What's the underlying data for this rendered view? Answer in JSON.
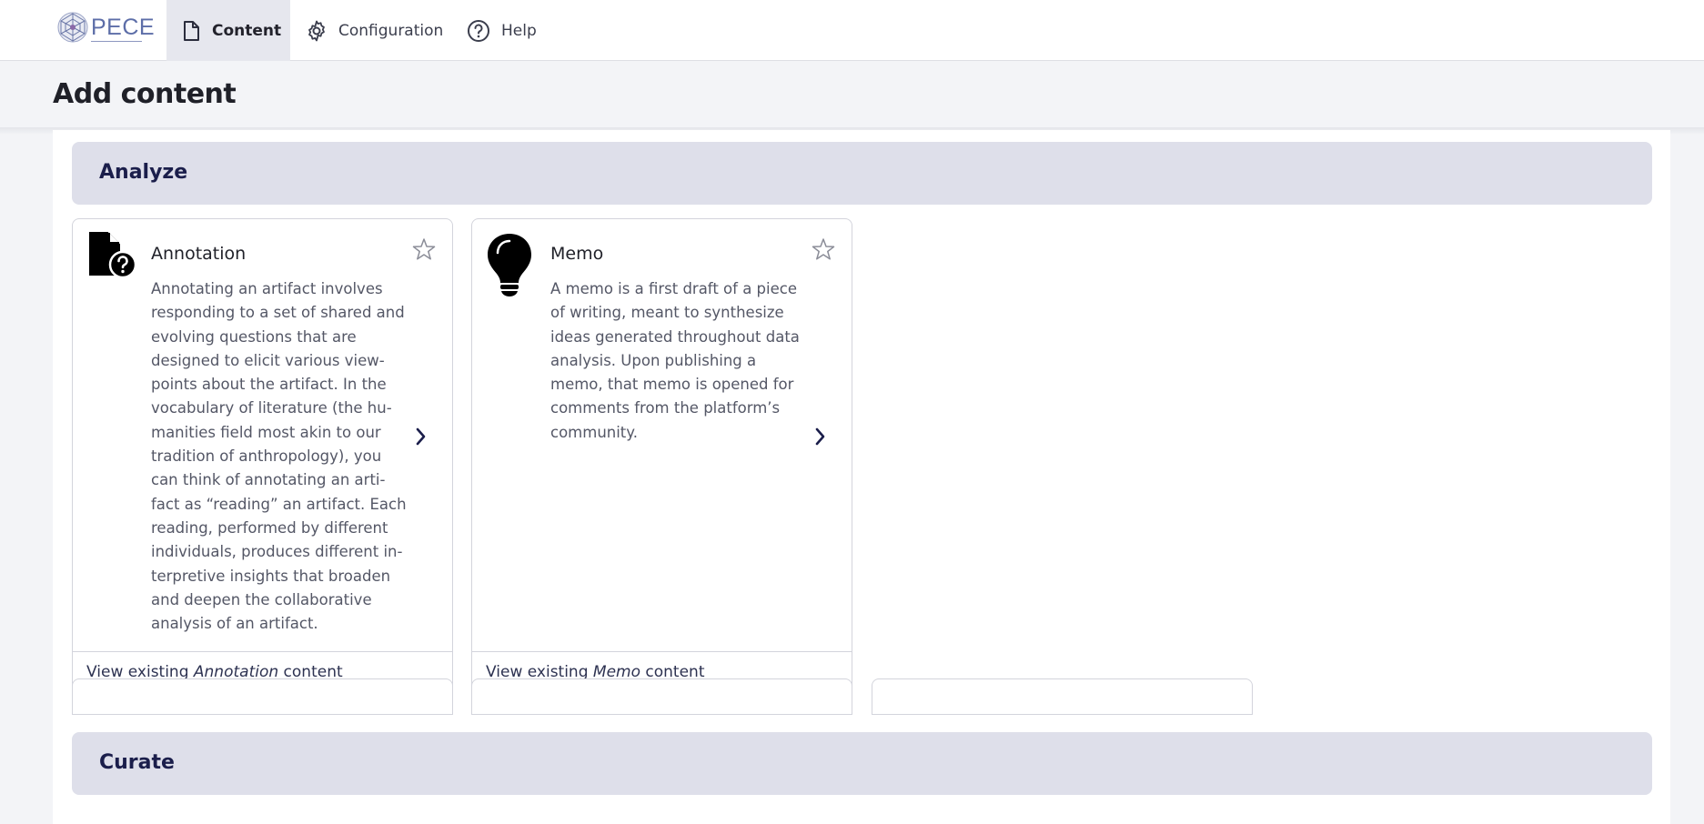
{
  "header": {
    "logo_text": "PECE",
    "tabs": [
      {
        "label": "Content",
        "icon": "document-icon",
        "active": true
      },
      {
        "label": "Configuration",
        "icon": "gear-icon",
        "active": false
      },
      {
        "label": "Help",
        "icon": "question-circle-icon",
        "active": false
      }
    ]
  },
  "page": {
    "title": "Add content"
  },
  "sections": [
    {
      "title": "Analyze",
      "cards": [
        {
          "title": "Annotation",
          "icon": "file-question-icon",
          "description": "Annotating an artifact involves responding to a set of shared and evolving questions that are designed to elicit various view-points about the artifact. In the vocabulary of literature (the hu-manities field most akin to our tradition of anthropology), you can think of annotating an arti-fact as “reading” an artifact. Each reading, performed by different individuals, produces different in-terpretive insights that broaden and deepen the collaborative analysis of an artifact.",
          "link_prefix": "View existing ",
          "link_type": "Annotation",
          "link_suffix": " content"
        },
        {
          "title": "Memo",
          "icon": "lightbulb-icon",
          "description": "A memo is a first draft of a piece of writing, meant to synthesize ideas generated throughout data analysis. Upon publishing a memo, that memo is opened for comments from the platform’s community.",
          "link_prefix": "View existing ",
          "link_type": "Memo",
          "link_suffix": " content"
        }
      ]
    },
    {
      "title": "Curate"
    }
  ],
  "colors": {
    "section_header_bg": "#dedfea",
    "section_header_text": "#1b1e4b",
    "active_tab_bg": "#e6e7ee"
  }
}
